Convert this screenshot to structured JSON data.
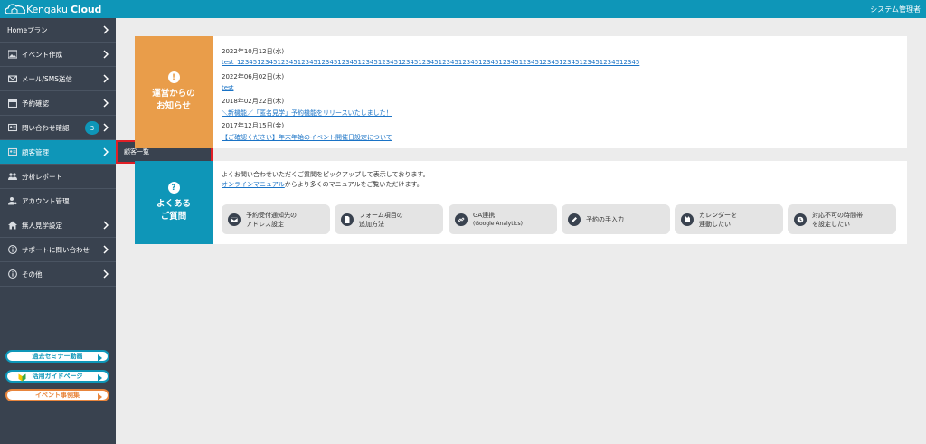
{
  "header": {
    "logo_prefix": "Kengaku",
    "logo_suffix": "Cloud",
    "user": "システム管理者"
  },
  "sidebar": {
    "items": [
      {
        "label": "Homeプラン"
      },
      {
        "label": "イベント作成"
      },
      {
        "label": "メール/SMS送信"
      },
      {
        "label": "予約確認"
      },
      {
        "label": "問い合わせ確認",
        "badge": "3"
      },
      {
        "label": "顧客管理"
      },
      {
        "label": "分析レポート"
      },
      {
        "label": "アカウント管理"
      },
      {
        "label": "無人見学設定"
      },
      {
        "label": "サポートに問い合わせ"
      },
      {
        "label": "その他"
      }
    ],
    "submenu": "顧客一覧",
    "pills": [
      "過去セミナー動画",
      "活用ガイドページ",
      "イベント事例集"
    ]
  },
  "announcements": {
    "icon": "!",
    "title_line1": "運営からの",
    "title_line2": "お知らせ",
    "items": [
      {
        "date": "2022年10月12日(水)",
        "text": "test_1234512345123451234512345123451234512345123451234512345123451234512345123451234512345123451234512345"
      },
      {
        "date": "2022年06月02日(木)",
        "text": "test"
      },
      {
        "date": "2018年02月22日(木)",
        "text": "＼新機能／「匿名見学」予約機能をリリースいたしました！"
      },
      {
        "date": "2017年12月15日(金)",
        "text": "【ご確認ください】年末年始のイベント開催日設定について"
      }
    ]
  },
  "faq": {
    "icon": "?",
    "title_line1": "よくある",
    "title_line2": "ご質問",
    "intro_line1": "よくお問い合わせいただくご質問をピックアップして表示しております。",
    "intro_link": "オンラインマニュアル",
    "intro_line2_rest": "からより多くのマニュアルをご覧いただけます。",
    "buttons": [
      {
        "line1": "予約受付通知先の",
        "line2": "アドレス設定",
        "icon": "mail-icon"
      },
      {
        "line1": "フォーム項目の",
        "line2": "追加方法",
        "icon": "document-icon"
      },
      {
        "line1": "GA連携",
        "line2": "(Google Analytics)",
        "icon": "link-icon"
      },
      {
        "line1": "予約の手入力",
        "line2": "",
        "icon": "pencil-icon"
      },
      {
        "line1": "カレンダーを",
        "line2": "連動したい",
        "icon": "calendar-icon"
      },
      {
        "line1": "対応不可の時間帯",
        "line2": "を設定したい",
        "icon": "clock-icon"
      }
    ]
  },
  "colors": {
    "header": "#0e96b8",
    "sidebar": "#39424f",
    "announce": "#e99d4a",
    "faq": "#0e96b8",
    "highlight": "#e01f26"
  }
}
